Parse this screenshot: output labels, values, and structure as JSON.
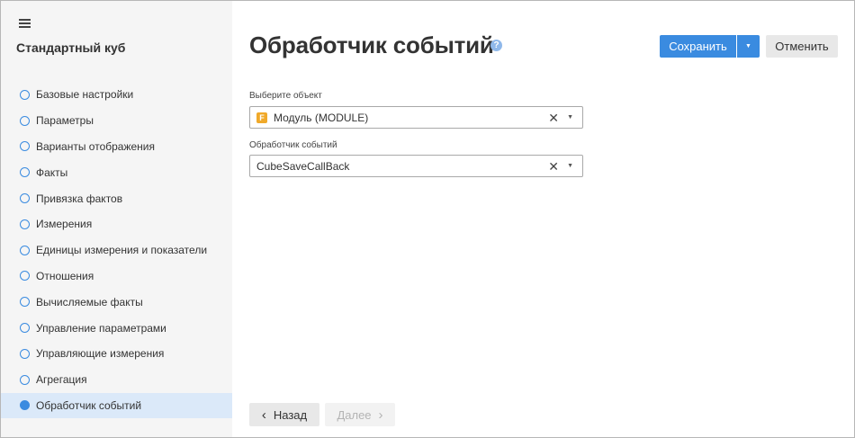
{
  "sidebar": {
    "title": "Стандартный куб",
    "items": [
      {
        "label": "Базовые настройки",
        "active": false
      },
      {
        "label": "Параметры",
        "active": false
      },
      {
        "label": "Варианты отображения",
        "active": false
      },
      {
        "label": "Факты",
        "active": false
      },
      {
        "label": "Привязка фактов",
        "active": false
      },
      {
        "label": "Измерения",
        "active": false
      },
      {
        "label": "Единицы измерения и показатели",
        "active": false
      },
      {
        "label": "Отношения",
        "active": false
      },
      {
        "label": "Вычисляемые факты",
        "active": false
      },
      {
        "label": "Управление параметрами",
        "active": false
      },
      {
        "label": "Управляющие измерения",
        "active": false
      },
      {
        "label": "Агрегация",
        "active": false
      },
      {
        "label": "Обработчик событий",
        "active": true
      }
    ]
  },
  "header": {
    "title": "Обработчик событий",
    "help_glyph": "?",
    "save_label": "Сохранить",
    "cancel_label": "Отменить"
  },
  "form": {
    "object_label": "Выберите объект",
    "object_icon_glyph": "F",
    "object_value": "Модуль (MODULE)",
    "handler_label": "Обработчик событий",
    "handler_value": "CubeSaveCallBack"
  },
  "footer": {
    "back_label": "Назад",
    "next_label": "Далее"
  },
  "colors": {
    "accent": "#3a8be0",
    "active_item_bg": "#dbe9f9",
    "sidebar_bg": "#f5f5f5",
    "module_icon": "#f0a92a"
  }
}
